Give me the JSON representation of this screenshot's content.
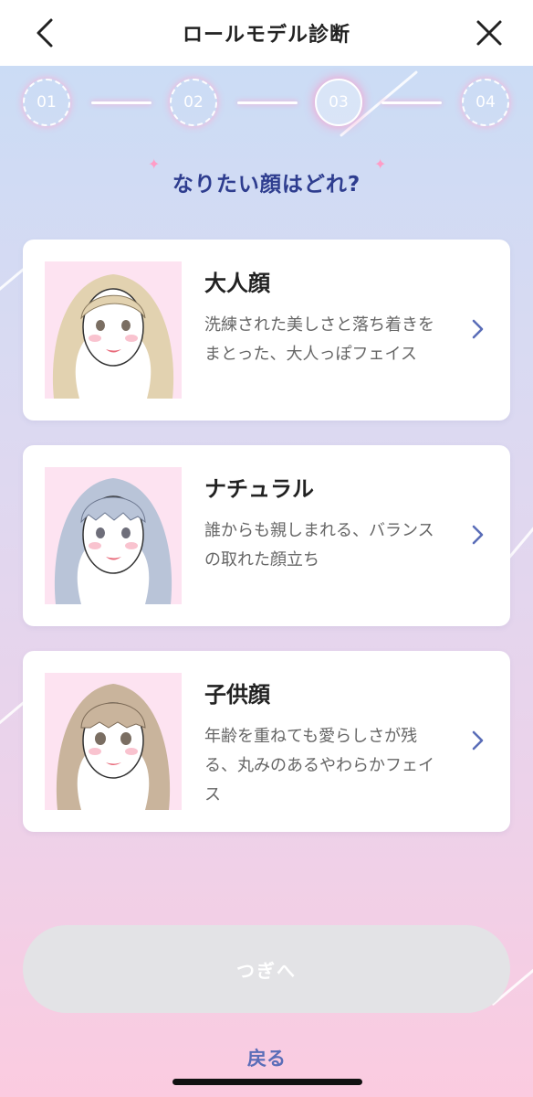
{
  "header": {
    "title": "ロールモデル診断"
  },
  "steps": [
    {
      "label": "01",
      "active": false
    },
    {
      "label": "02",
      "active": false
    },
    {
      "label": "03",
      "active": true
    },
    {
      "label": "04",
      "active": false
    }
  ],
  "question": "なりたい顔はどれ?",
  "options": [
    {
      "name": "大人顔",
      "description": "洗練された美しさと落ち着きをまとった、大人っぽフェイス"
    },
    {
      "name": "ナチュラル",
      "description": "誰からも親しまれる、バランスの取れた顔立ち"
    },
    {
      "name": "子供顔",
      "description": "年齢を重ねても愛らしさが残る、丸みのあるやわらかフェイス"
    }
  ],
  "next_button": "つぎへ",
  "back_link": "戻る",
  "colors": {
    "accent": "#2e3d8f",
    "link": "#5a6db8",
    "disabled_button": "#e3e3e6",
    "portrait_bg": "#fde3f1"
  }
}
